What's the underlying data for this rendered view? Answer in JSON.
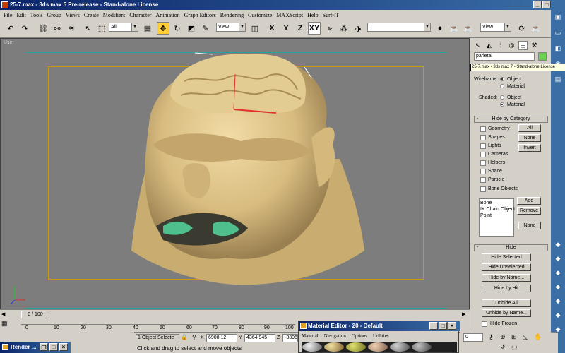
{
  "window": {
    "title": "25-7.max - 3ds max 5 Pre-release - Stand-alone License"
  },
  "menu": [
    "File",
    "Edit",
    "Tools",
    "Group",
    "Views",
    "Create",
    "Modifiers",
    "Character",
    "Animation",
    "Graph Editors",
    "Rendering",
    "Customize",
    "MAXScript",
    "Help",
    "Surf-iT"
  ],
  "toolbar": {
    "selection_filter": "All",
    "ref_coord": "View",
    "view2": "View",
    "axis_x": "X",
    "axis_y": "Y",
    "axis_z": "Z",
    "axis_xy": "XY"
  },
  "viewport": {
    "label": "User"
  },
  "command_panel": {
    "object_name": "parietal",
    "tooltip": "25-7.max - 3ds max 7 - Stand-alone License",
    "wireframe_label": "Wireframe:",
    "shaded_label": "Shaded:",
    "opt_object": "Object",
    "opt_material": "Material",
    "hide_by_category": "Hide by Category",
    "categories": [
      "Geometry",
      "Shapes",
      "Lights",
      "Cameras",
      "Helpers",
      "Space",
      "Particle",
      "Bone Objects"
    ],
    "btn_all": "All",
    "btn_none": "None",
    "btn_invert": "Invert",
    "list_items": [
      "Bone",
      "IK Chain Object",
      "Point"
    ],
    "btn_add": "Add",
    "btn_remove": "Remove",
    "btn_none2": "None",
    "hide": "Hide",
    "btn_hide_selected": "Hide Selected",
    "btn_hide_unselected": "Hide Unselected",
    "btn_hide_by_name": "Hide by Name...",
    "btn_hide_by_hit": "Hide by Hit",
    "btn_unhide_all": "Unhide All",
    "btn_unhide_by_name": "Unhide by Name...",
    "hide_frozen": "Hide Frozen"
  },
  "timeline": {
    "slider": "0 / 100",
    "ticks": [
      "0",
      "10",
      "20",
      "30",
      "40",
      "50",
      "60",
      "70",
      "80",
      "90",
      "100"
    ]
  },
  "status": {
    "selection": "1 Object Selecte",
    "x_val": "6908.12",
    "y_val": "4364.945",
    "z_val": "-3396.5",
    "prompt": "Click and drag to select and move objects"
  },
  "material_editor": {
    "title": "Material Editor - 20 - Default",
    "menu": [
      "Material",
      "Navigation",
      "Options",
      "Utilities"
    ]
  },
  "render_window": {
    "title": "Render ..."
  }
}
